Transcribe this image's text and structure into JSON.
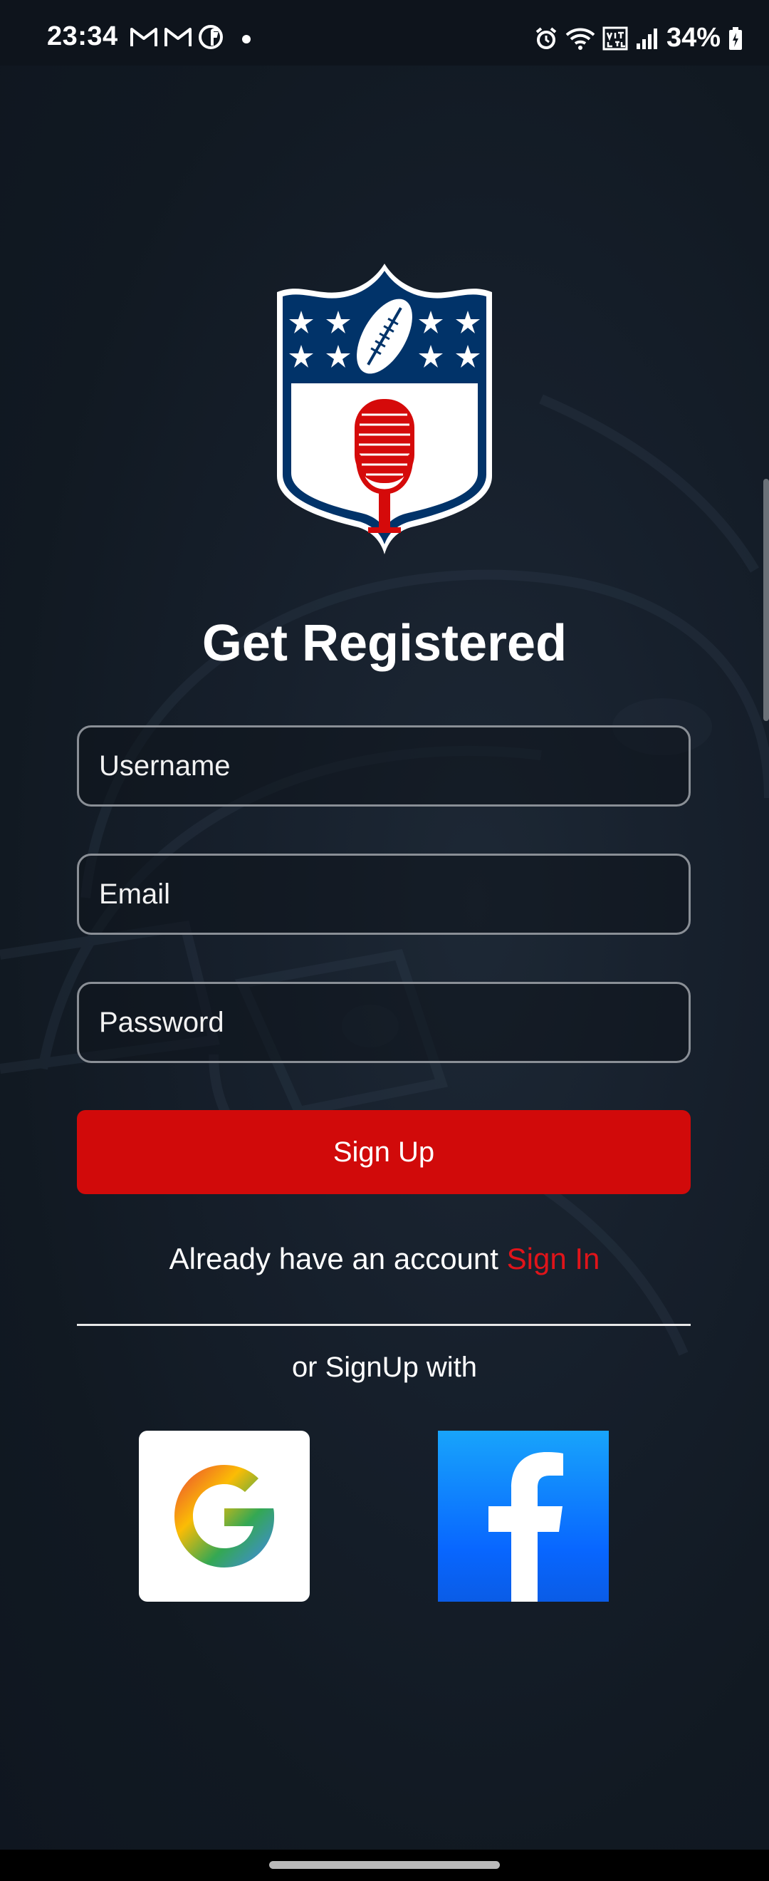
{
  "status_bar": {
    "time": "23:34",
    "left_icons": [
      "gmail-icon",
      "gmail-icon",
      "facebook-messenger-icon"
    ],
    "right_icons": [
      "alarm-icon",
      "wifi-icon",
      "volte-icon",
      "signal-icon"
    ],
    "battery_text": "34%",
    "battery_icon": "battery-charging-icon"
  },
  "logo": {
    "icon": "nfl-shield-microphone-logo"
  },
  "form": {
    "title": "Get Registered",
    "username_placeholder": "Username",
    "email_placeholder": "Email",
    "password_placeholder": "Password",
    "submit_label": "Sign Up"
  },
  "signin": {
    "prompt": "Already have an account ",
    "link": "Sign In"
  },
  "social": {
    "label": "or SignUp with",
    "providers": [
      "google-icon",
      "facebook-icon"
    ]
  },
  "colors": {
    "background": "#121a24",
    "accent": "#d10a0a",
    "link": "#e0141a",
    "shield_blue": "#013369"
  }
}
